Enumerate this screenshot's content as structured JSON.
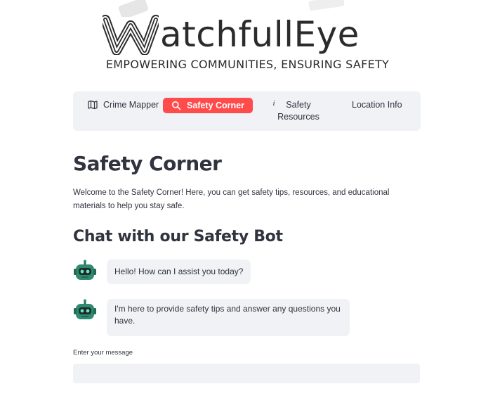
{
  "brand": {
    "logo_text": "atchfullEye",
    "logo_letter": "W",
    "tagline": "EMPOWERING COMMUNITIES, ENSURING SAFETY"
  },
  "nav": {
    "items": [
      {
        "label": "Crime Mapper",
        "icon": "map-icon"
      },
      {
        "label": "Safety Corner",
        "icon": "search-icon",
        "active": true
      },
      {
        "label": "Safety Resources",
        "icon": "info-icon"
      },
      {
        "label": "Location Info",
        "icon": "none"
      }
    ]
  },
  "main": {
    "title": "Safety Corner",
    "intro": "Welcome to the Safety Corner! Here, you can get safety tips, resources, and educational materials to help you stay safe.",
    "chat_title": "Chat with our Safety Bot",
    "messages": [
      {
        "avatar": "robot-icon",
        "text": "Hello! How can I assist you today?"
      },
      {
        "avatar": "robot-icon",
        "text": "I'm here to provide safety tips and answer any questions you have."
      }
    ],
    "input_label": "Enter your message",
    "input_value": ""
  },
  "colors": {
    "accent": "#ff4b4b",
    "panel": "#f0f2f6",
    "text": "#31333f",
    "robot": "#2e8b6f"
  }
}
